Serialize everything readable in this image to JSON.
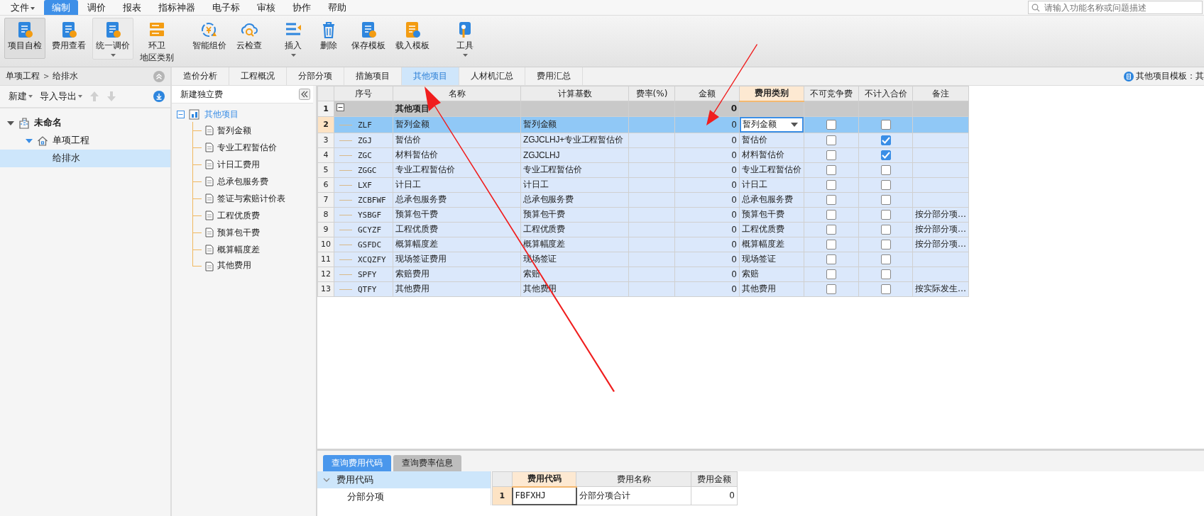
{
  "menu": [
    {
      "label": "文件",
      "has_menu": true,
      "selected": false
    },
    {
      "label": "编制",
      "has_menu": false,
      "selected": true
    },
    {
      "label": "调价",
      "has_menu": false,
      "selected": false
    },
    {
      "label": "报表",
      "has_menu": false,
      "selected": false
    },
    {
      "label": "指标神器",
      "has_menu": false,
      "selected": false
    },
    {
      "label": "电子标",
      "has_menu": false,
      "selected": false
    },
    {
      "label": "审核",
      "has_menu": false,
      "selected": false
    },
    {
      "label": "协作",
      "has_menu": false,
      "selected": false
    },
    {
      "label": "帮助",
      "has_menu": false,
      "selected": false
    }
  ],
  "search": {
    "placeholder": "请输入功能名称或问题描述"
  },
  "toolbar": [
    {
      "label": "项目自检",
      "pressed": true,
      "has_menu": false
    },
    {
      "label": "费用查看",
      "pressed": false,
      "has_menu": false
    },
    {
      "label": "统一调价",
      "pressed": false,
      "has_menu": true
    },
    {
      "label": "环卫",
      "sublabel": "地区类别",
      "pressed": false,
      "has_menu": false
    },
    {
      "label": "智能组价",
      "pressed": false,
      "has_menu": false
    },
    {
      "label": "云检查",
      "pressed": false,
      "has_menu": false
    },
    {
      "label": "插入",
      "pressed": false,
      "has_menu": true
    },
    {
      "label": "删除",
      "pressed": false,
      "has_menu": false
    },
    {
      "label": "保存模板",
      "pressed": false,
      "has_menu": false
    },
    {
      "label": "载入模板",
      "pressed": false,
      "has_menu": false
    },
    {
      "label": "工具",
      "pressed": false,
      "has_menu": true
    }
  ],
  "breadcrumb": {
    "items": [
      "单项工程",
      "给排水"
    ],
    "separator": ">"
  },
  "project_toolbar": {
    "new": "新建",
    "import_export": "导入导出"
  },
  "project_tree": [
    {
      "label": "未命名",
      "expanded": true,
      "selected": false,
      "children": [
        {
          "label": "单项工程",
          "expanded": true,
          "selected": false,
          "children": [
            {
              "label": "给排水",
              "selected": true
            }
          ]
        }
      ]
    }
  ],
  "tabs": [
    {
      "label": "造价分析",
      "selected": false
    },
    {
      "label": "工程概况",
      "selected": false
    },
    {
      "label": "分部分项",
      "selected": false
    },
    {
      "label": "措施项目",
      "selected": false
    },
    {
      "label": "其他项目",
      "selected": true
    },
    {
      "label": "人材机汇总",
      "selected": false
    },
    {
      "label": "费用汇总",
      "selected": false
    }
  ],
  "template_label": "其他项目模板：其",
  "fee_tree": {
    "header": "新建独立费",
    "root": {
      "label": "其他项目",
      "expanded": true,
      "children": [
        "暂列金额",
        "专业工程暂估价",
        "计日工费用",
        "总承包服务费",
        "签证与索赔计价表",
        "工程优质费",
        "预算包干费",
        "概算幅度差",
        "其他费用"
      ]
    }
  },
  "table": {
    "columns": [
      {
        "label": "序号",
        "current": false
      },
      {
        "label": "名称",
        "current": false
      },
      {
        "label": "计算基数",
        "current": false
      },
      {
        "label": "费率(%)",
        "current": false
      },
      {
        "label": "金额",
        "current": false
      },
      {
        "label": "费用类别",
        "current": true
      },
      {
        "label": "不可竞争费",
        "current": false
      },
      {
        "label": "不计入合价",
        "current": false
      },
      {
        "label": "备注",
        "current": false
      }
    ],
    "rows": [
      {
        "kind": "group",
        "num": "1",
        "code": "",
        "name": "其他项目",
        "base": "",
        "rate": "",
        "amount": "0",
        "category": "",
        "expanded": true,
        "selected": false
      },
      {
        "kind": "item",
        "num": "2",
        "code": "ZLF",
        "name": "暂列金额",
        "base": "暂列金额",
        "rate": "",
        "amount": "0",
        "category": "暂列金额",
        "noncompetitive": false,
        "excluded": false,
        "note": "",
        "selected": true
      },
      {
        "kind": "item",
        "num": "3",
        "code": "ZGJ",
        "name": "暂估价",
        "base": "ZGJCLHJ+专业工程暂估价",
        "rate": "",
        "amount": "0",
        "category": "暂估价",
        "noncompetitive": false,
        "excluded": true,
        "note": "",
        "selected": false
      },
      {
        "kind": "item",
        "num": "4",
        "code": "ZGC",
        "name": "材料暂估价",
        "base": "ZGJCLHJ",
        "rate": "",
        "amount": "0",
        "category": "材料暂估价",
        "noncompetitive": false,
        "excluded": true,
        "note": "",
        "selected": false
      },
      {
        "kind": "item",
        "num": "5",
        "code": "ZGGC",
        "name": "专业工程暂估价",
        "base": "专业工程暂估价",
        "rate": "",
        "amount": "0",
        "category": "专业工程暂估价",
        "noncompetitive": false,
        "excluded": false,
        "note": "",
        "selected": false
      },
      {
        "kind": "item",
        "num": "6",
        "code": "LXF",
        "name": "计日工",
        "base": "计日工",
        "rate": "",
        "amount": "0",
        "category": "计日工",
        "noncompetitive": false,
        "excluded": false,
        "note": "",
        "selected": false
      },
      {
        "kind": "item",
        "num": "7",
        "code": "ZCBFWF",
        "name": "总承包服务费",
        "base": "总承包服务费",
        "rate": "",
        "amount": "0",
        "category": "总承包服务费",
        "noncompetitive": false,
        "excluded": false,
        "note": "",
        "selected": false
      },
      {
        "kind": "item",
        "num": "8",
        "code": "YSBGF",
        "name": "预算包干费",
        "base": "预算包干费",
        "rate": "",
        "amount": "0",
        "category": "预算包干费",
        "noncompetitive": false,
        "excluded": false,
        "note": "按分部分项…",
        "selected": false
      },
      {
        "kind": "item",
        "num": "9",
        "code": "GCYZF",
        "name": "工程优质费",
        "base": "工程优质费",
        "rate": "",
        "amount": "0",
        "category": "工程优质费",
        "noncompetitive": false,
        "excluded": false,
        "note": "按分部分项…",
        "selected": false
      },
      {
        "kind": "item",
        "num": "10",
        "code": "GSFDC",
        "name": "概算幅度差",
        "base": "概算幅度差",
        "rate": "",
        "amount": "0",
        "category": "概算幅度差",
        "noncompetitive": false,
        "excluded": false,
        "note": "按分部分项…",
        "selected": false
      },
      {
        "kind": "item",
        "num": "11",
        "code": "XCQZFY",
        "name": "现场签证费用",
        "base": "现场签证",
        "rate": "",
        "amount": "0",
        "category": "现场签证",
        "noncompetitive": false,
        "excluded": false,
        "note": "",
        "selected": false
      },
      {
        "kind": "item",
        "num": "12",
        "code": "SPFY",
        "name": "索赔费用",
        "base": "索赔",
        "rate": "",
        "amount": "0",
        "category": "索赔",
        "noncompetitive": false,
        "excluded": false,
        "note": "",
        "selected": false
      },
      {
        "kind": "item",
        "num": "13",
        "code": "QTFY",
        "name": "其他费用",
        "base": "其他费用",
        "rate": "",
        "amount": "0",
        "category": "其他费用",
        "noncompetitive": false,
        "excluded": false,
        "note": "按实际发生…",
        "selected": false
      }
    ]
  },
  "bottom": {
    "tabs": [
      {
        "label": "查询费用代码",
        "selected": true
      },
      {
        "label": "查询费率信息",
        "selected": false
      }
    ],
    "tree": [
      {
        "label": "费用代码",
        "expanded": true,
        "selected": true,
        "children": [
          "分部分项"
        ]
      }
    ],
    "grid": {
      "columns": [
        {
          "label": "费用代码",
          "current": true
        },
        {
          "label": "费用名称",
          "current": false
        },
        {
          "label": "费用金额",
          "current": false
        }
      ],
      "rows": [
        {
          "num": "1",
          "code": "FBFXHJ",
          "name": "分部分项合计",
          "amount": "0",
          "selected": true
        }
      ]
    }
  },
  "annotations": [
    {
      "kind": "arrow"
    },
    {
      "kind": "arrow"
    }
  ]
}
